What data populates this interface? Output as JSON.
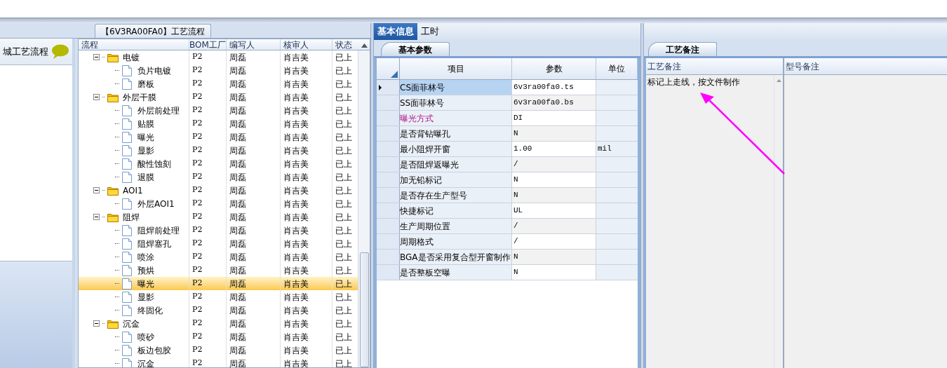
{
  "left_panel": {
    "item": "城工艺流程"
  },
  "flow_tab": {
    "title": "【6V3RA00FA0】工艺流程"
  },
  "flow_table": {
    "columns": [
      "流程",
      "BOM工厂",
      "编写人",
      "核审人",
      "状态"
    ],
    "tree": [
      {
        "name": "电镀",
        "bom": "P2",
        "writer": "周磊",
        "reviewer": "肖吉美",
        "status": "已上",
        "expanded": true,
        "selected": false,
        "children": [
          {
            "name": "负片电镀",
            "bom": "P2",
            "writer": "周磊",
            "reviewer": "肖吉美",
            "status": "已上",
            "selected": false
          },
          {
            "name": "磨板",
            "bom": "P2",
            "writer": "周磊",
            "reviewer": "肖吉美",
            "status": "已上",
            "selected": false
          }
        ]
      },
      {
        "name": "外层干膜",
        "bom": "P2",
        "writer": "周磊",
        "reviewer": "肖吉美",
        "status": "已上",
        "expanded": true,
        "selected": false,
        "children": [
          {
            "name": "外层前处理",
            "bom": "P2",
            "writer": "周磊",
            "reviewer": "肖吉美",
            "status": "已上",
            "selected": false
          },
          {
            "name": "贴膜",
            "bom": "P2",
            "writer": "周磊",
            "reviewer": "肖吉美",
            "status": "已上",
            "selected": false
          },
          {
            "name": "曝光",
            "bom": "P2",
            "writer": "周磊",
            "reviewer": "肖吉美",
            "status": "已上",
            "selected": false
          },
          {
            "name": "显影",
            "bom": "P2",
            "writer": "周磊",
            "reviewer": "肖吉美",
            "status": "已上",
            "selected": false
          },
          {
            "name": "酸性蚀刻",
            "bom": "P2",
            "writer": "周磊",
            "reviewer": "肖吉美",
            "status": "已上",
            "selected": false
          },
          {
            "name": "退膜",
            "bom": "P2",
            "writer": "周磊",
            "reviewer": "肖吉美",
            "status": "已上",
            "selected": false
          }
        ]
      },
      {
        "name": "AOI1",
        "bom": "P2",
        "writer": "周磊",
        "reviewer": "肖吉美",
        "status": "已上",
        "expanded": true,
        "selected": false,
        "children": [
          {
            "name": "外层AOI1",
            "bom": "P2",
            "writer": "周磊",
            "reviewer": "肖吉美",
            "status": "已上",
            "selected": false
          }
        ]
      },
      {
        "name": "阻焊",
        "bom": "P2",
        "writer": "周磊",
        "reviewer": "肖吉美",
        "status": "已上",
        "expanded": true,
        "selected": false,
        "children": [
          {
            "name": "阻焊前处理",
            "bom": "P2",
            "writer": "周磊",
            "reviewer": "肖吉美",
            "status": "已上",
            "selected": false
          },
          {
            "name": "阻焊塞孔",
            "bom": "P2",
            "writer": "周磊",
            "reviewer": "肖吉美",
            "status": "已上",
            "selected": false
          },
          {
            "name": "喷涂",
            "bom": "P2",
            "writer": "周磊",
            "reviewer": "肖吉美",
            "status": "已上",
            "selected": false
          },
          {
            "name": "预烘",
            "bom": "P2",
            "writer": "周磊",
            "reviewer": "肖吉美",
            "status": "已上",
            "selected": false
          },
          {
            "name": "曝光",
            "bom": "P2",
            "writer": "周磊",
            "reviewer": "肖吉美",
            "status": "已上",
            "selected": true
          },
          {
            "name": "显影",
            "bom": "P2",
            "writer": "周磊",
            "reviewer": "肖吉美",
            "status": "已上",
            "selected": false
          },
          {
            "name": "终固化",
            "bom": "P2",
            "writer": "周磊",
            "reviewer": "肖吉美",
            "status": "已上",
            "selected": false
          }
        ]
      },
      {
        "name": "沉金",
        "bom": "P2",
        "writer": "周磊",
        "reviewer": "肖吉美",
        "status": "已上",
        "expanded": true,
        "selected": false,
        "children": [
          {
            "name": "喷砂",
            "bom": "P2",
            "writer": "周磊",
            "reviewer": "肖吉美",
            "status": "已上",
            "selected": false
          },
          {
            "name": "板边包胶",
            "bom": "P2",
            "writer": "周磊",
            "reviewer": "肖吉美",
            "status": "已上",
            "selected": false
          },
          {
            "name": "沉金",
            "bom": "P2",
            "writer": "周磊",
            "reviewer": "肖吉美",
            "status": "已上",
            "selected": false
          }
        ]
      }
    ]
  },
  "tabs": [
    {
      "label": "基本信息",
      "selected": true
    },
    {
      "label": "工时",
      "selected": false
    }
  ],
  "params_panel": {
    "tab": "基本参数",
    "columns": [
      "项目",
      "参数",
      "单位"
    ],
    "rows": [
      {
        "item": "CS面菲林号",
        "value": "6v3ra00fa0.ts",
        "current": true,
        "emphasized": false
      },
      {
        "item": "SS面菲林号",
        "value": "6v3ra00fa0.bs",
        "current": false,
        "emphasized": false
      },
      {
        "item": "曝光方式",
        "value": "DI",
        "current": false,
        "emphasized": true
      },
      {
        "item": "是否背钻曝孔",
        "value": "N",
        "current": false,
        "emphasized": false
      },
      {
        "item": "最小阻焊开窗",
        "value": "1.00",
        "unit": "mil",
        "current": false,
        "emphasized": false
      },
      {
        "item": "是否阻焊返曝光",
        "value": "/",
        "current": false,
        "emphasized": false
      },
      {
        "item": "加无铅标记",
        "value": "N",
        "current": false,
        "emphasized": false
      },
      {
        "item": "是否存在生产型号",
        "value": "N",
        "current": false,
        "emphasized": false
      },
      {
        "item": "快捷标记",
        "value": "UL",
        "current": false,
        "emphasized": false
      },
      {
        "item": "生产周期位置",
        "value": "/",
        "current": false,
        "emphasized": false
      },
      {
        "item": "周期格式",
        "value": "/",
        "current": false,
        "emphasized": false
      },
      {
        "item": "BGA是否采用复合型开窗制作",
        "value": "N",
        "current": false,
        "emphasized": false
      },
      {
        "item": "是否整板空曝",
        "value": "N",
        "current": false,
        "emphasized": false
      }
    ]
  },
  "notes_panel": {
    "tab": "工艺备注",
    "columns": [
      "工艺备注",
      "型号备注"
    ],
    "process_note": "标记上走线，按文件制作"
  }
}
